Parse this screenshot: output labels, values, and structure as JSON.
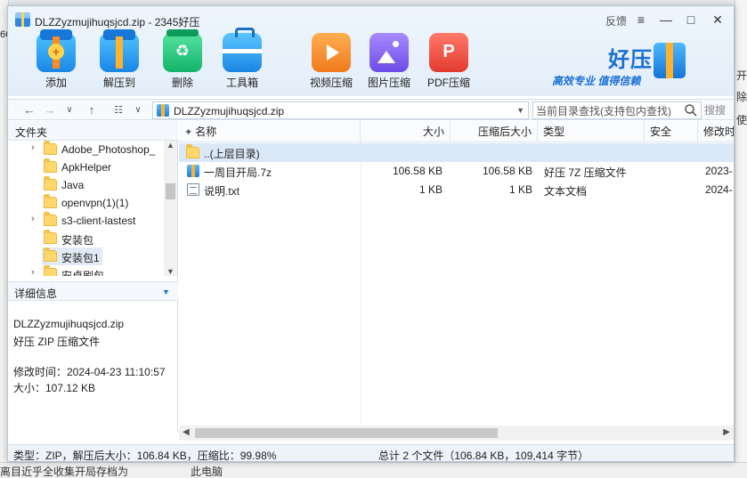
{
  "background": {
    "right_texts": [
      "开",
      "除",
      "使"
    ],
    "left_text": "66",
    "bottom_left": "离目近乎全收集开局存档为",
    "bottom_right": "此电脑"
  },
  "window": {
    "title": "DLZZyzmujihuqsjcd.zip - 2345好压",
    "feedback": "反馈",
    "menu_icon": "≡",
    "minimize_icon": "—",
    "maximize_icon": "□",
    "close_icon": "✕"
  },
  "toolbar": {
    "add": "添加",
    "extract": "解压到",
    "delete": "删除",
    "toolbox": "工具箱",
    "video": "视频压缩",
    "image": "图片压缩",
    "pdf": "PDF压缩"
  },
  "brand": {
    "name": "好压",
    "slogan": "高效专业 值得信赖"
  },
  "address": {
    "path": "DLZZyzmujihuqsjcd.zip",
    "search_placeholder": "当前目录查找(支持包内查找)",
    "search_button": "搜搜"
  },
  "tree": {
    "header": "文件夹",
    "items": [
      {
        "label": "Adobe_Photoshop_",
        "arrow": "›"
      },
      {
        "label": "ApkHelper",
        "arrow": ""
      },
      {
        "label": "Java",
        "arrow": ""
      },
      {
        "label": "openvpn(1)(1)",
        "arrow": ""
      },
      {
        "label": "s3-client-lastest",
        "arrow": "›"
      },
      {
        "label": "安装包",
        "arrow": ""
      },
      {
        "label": "安装包1",
        "arrow": ""
      },
      {
        "label": "安卓刷包",
        "arrow": "›"
      }
    ]
  },
  "details": {
    "header": "详细信息",
    "filename": "DLZZyzmujihuqsjcd.zip",
    "filetype": "好压 ZIP 压缩文件",
    "modified": "修改时间：2024-04-23 11:10:57",
    "size": "大小：107.12 KB"
  },
  "columns": {
    "name": "名称",
    "size": "大小",
    "packed": "压缩后大小",
    "type": "类型",
    "security": "安全",
    "modified": "修改时"
  },
  "files": [
    {
      "name": "..(上层目录)",
      "size": "",
      "packed": "",
      "type": "",
      "modified": "",
      "icon": "folder-icon"
    },
    {
      "name": "一周目开局.7z",
      "size": "106.58 KB",
      "packed": "106.58 KB",
      "type": "好压 7Z 压缩文件",
      "modified": "2023-",
      "icon": "archive-icon"
    },
    {
      "name": "说明.txt",
      "size": "1 KB",
      "packed": "1 KB",
      "type": "文本文档",
      "modified": "2024-",
      "icon": "text-file-icon"
    }
  ],
  "status": {
    "left": "类型：ZIP，解压后大小：106.84 KB，压缩比：99.98%",
    "right": "总计 2 个文件（106.84 KB，109,414 字节）"
  },
  "colors": {
    "accent": "#1a6fd6",
    "selection": "#dbe8f7"
  }
}
